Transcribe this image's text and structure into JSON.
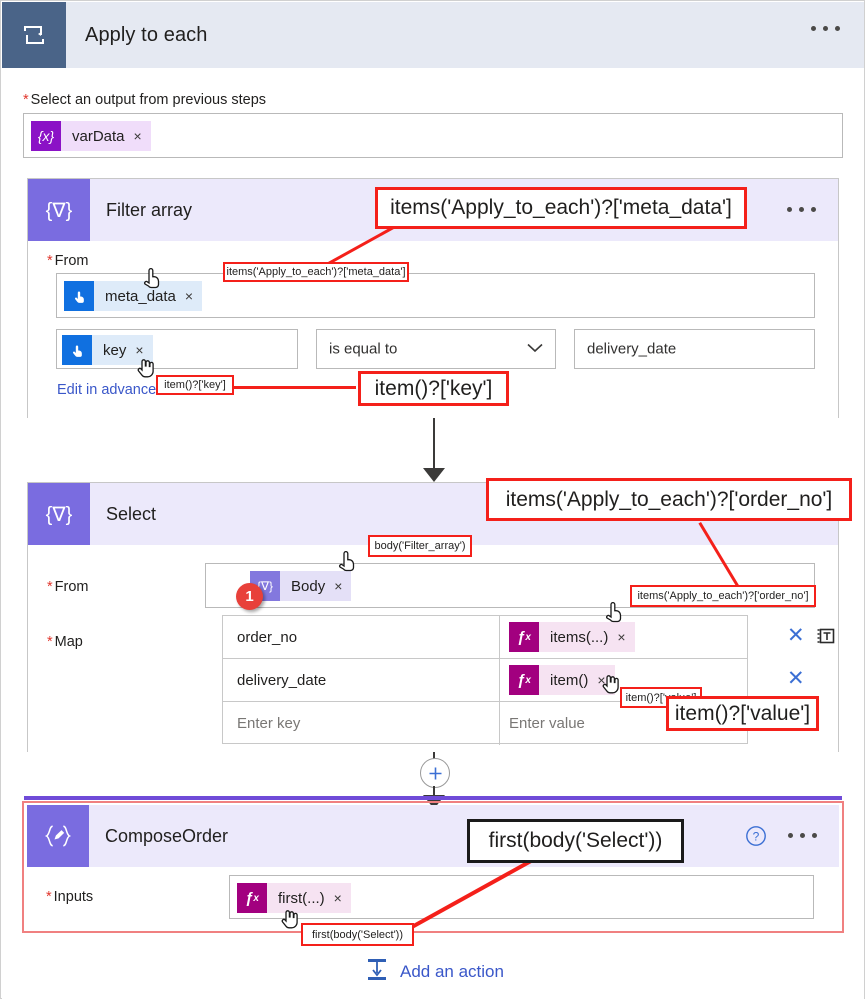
{
  "header": {
    "title": "Apply to each",
    "icon": "loop-icon",
    "menu_icon": "ellipsis-icon"
  },
  "foreach": {
    "label": "Select an output from previous steps",
    "required": true,
    "token": {
      "icon": "variable-icon",
      "icon_glyph": "{x}",
      "label": "varData",
      "remove": "×"
    }
  },
  "filter_card": {
    "icon_glyph": "{∇}",
    "icon": "filter-array-icon",
    "title": "Filter array",
    "menu_icon": "ellipsis-icon",
    "from_label": "From",
    "from_token": {
      "icon": "manual-trigger-icon",
      "label": "meta_data",
      "remove": "×"
    },
    "condition_left_token": {
      "icon": "manual-trigger-icon",
      "label": "key",
      "remove": "×"
    },
    "operator": "is equal to",
    "operator_chevron": "chevron-down-icon",
    "right_value": "delivery_date",
    "advanced_link": "Edit in advanced mode"
  },
  "select_card": {
    "icon_glyph": "{∇}",
    "icon": "select-icon",
    "title": "Select",
    "from_label": "From",
    "from_badge": "1",
    "from_token": {
      "icon": "filter-array-icon",
      "icon_glyph": "{∇}",
      "label": "Body",
      "remove": "×"
    },
    "map_label": "Map",
    "map_rows": [
      {
        "key": "order_no",
        "value_token": {
          "icon": "fx-icon",
          "label": "items(...)",
          "remove": "×"
        },
        "key_placeholder": false,
        "delete_icon": "close-icon",
        "switch_icon": "switch-to-text-mode-icon"
      },
      {
        "key": "delivery_date",
        "value_token": {
          "icon": "fx-icon",
          "label": "item()",
          "remove": "×"
        },
        "key_placeholder": false,
        "delete_icon": "close-icon"
      },
      {
        "key": "Enter key",
        "value": "Enter value",
        "key_placeholder": true
      }
    ]
  },
  "compose_card": {
    "icon_glyph": "{✎}",
    "icon": "compose-icon",
    "title": "ComposeOrder",
    "help_icon": "help-icon",
    "menu_icon": "ellipsis-icon",
    "inputs_label": "Inputs",
    "inputs_token": {
      "icon": "fx-icon",
      "label": "first(...)",
      "remove": "×"
    }
  },
  "add_action": {
    "label": "Add an action",
    "icon": "add-action-icon"
  },
  "annotations": {
    "meta_data_big": "items('Apply_to_each')?['meta_data']",
    "meta_data_tip": "items('Apply_to_each')?['meta_data']",
    "key_big": "item()?['key']",
    "key_tip": "item()?['key']",
    "order_no_big": "items('Apply_to_each')?['order_no']",
    "order_no_tip": "items('Apply_to_each')?['order_no']",
    "body_tip": "body('Filter_array')",
    "value_big": "item()?['value']",
    "value_tip": "item()?['value']",
    "first_big": "first(body('Select'))",
    "first_tip": "first(body('Select'))"
  },
  "colors": {
    "header_bg": "#e5e9f2",
    "header_icon_bg": "#4a6488",
    "card_head_bg": "#ece9fb",
    "card_icon_bg": "#7a6ce0",
    "annotation_red": "#f4201a",
    "link_blue": "#3a57c9",
    "token_variable": "#8b12c6",
    "token_blue": "#1070e0",
    "token_fx": "#a2007f",
    "badge_red": "#e8403a"
  }
}
